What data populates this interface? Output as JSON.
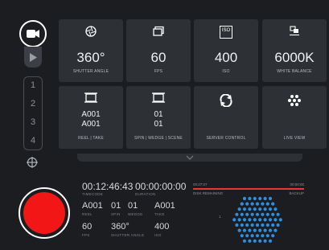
{
  "sidebar": {
    "camera_icon": "video-camera-icon",
    "play_icon": "play-icon",
    "slots": [
      "1",
      "2",
      "3",
      "4"
    ],
    "crosshair_icon": "crosshair-icon"
  },
  "tiles": [
    {
      "icon": "shutter-icon",
      "value": "360°",
      "label": "SHUTTER ANGLE"
    },
    {
      "icon": "fps-frames-icon",
      "value": "60",
      "label": "FPS"
    },
    {
      "icon": "iso-icon",
      "value": "400",
      "label": "ISO",
      "icon_text": "ISO"
    },
    {
      "icon": "white-balance-icon",
      "value": "6000K",
      "label": "WHITE BALANCE"
    },
    {
      "icon": "reel-icon",
      "value_line1": "A001",
      "value_line2": "A001",
      "label": "REEL | TAKE"
    },
    {
      "icon": "slate-icon",
      "value_line1": "01",
      "value_line2": "01",
      "label": "SPIN | WEDGE | SCENE"
    },
    {
      "icon": "sync-icon",
      "label": "SERVER CONTROL"
    },
    {
      "icon": "live-view-icon",
      "label": "LIVE VIEW"
    }
  ],
  "status": {
    "timecode": "00:12:46:43",
    "timecode_label": "TIMECODE",
    "duration": "00:00:00:00",
    "duration_label": "DURATION",
    "reel": "A001",
    "reel_label": "REEL",
    "spin": "01",
    "spin_label": "SPIN",
    "wedge": "01",
    "wedge_label": "WEDGE",
    "take": "A001",
    "take_label": "TAKE",
    "fps": "60",
    "fps_label": "FPS",
    "shutter": "360°",
    "shutter_label": "SHUTTER ANGLE",
    "iso": "400",
    "iso_label": "ISO"
  },
  "recording": {
    "disk_remaining_time": "00:27:07",
    "disk_remaining_label": "DISK REMAINING",
    "backup_time": "00:00:00",
    "backup_label": "BACKUP",
    "bar_marker": "1",
    "colors": {
      "record": "#f21616",
      "disk_bar": "#e03b3b",
      "dots": "#2d8fe0"
    }
  }
}
